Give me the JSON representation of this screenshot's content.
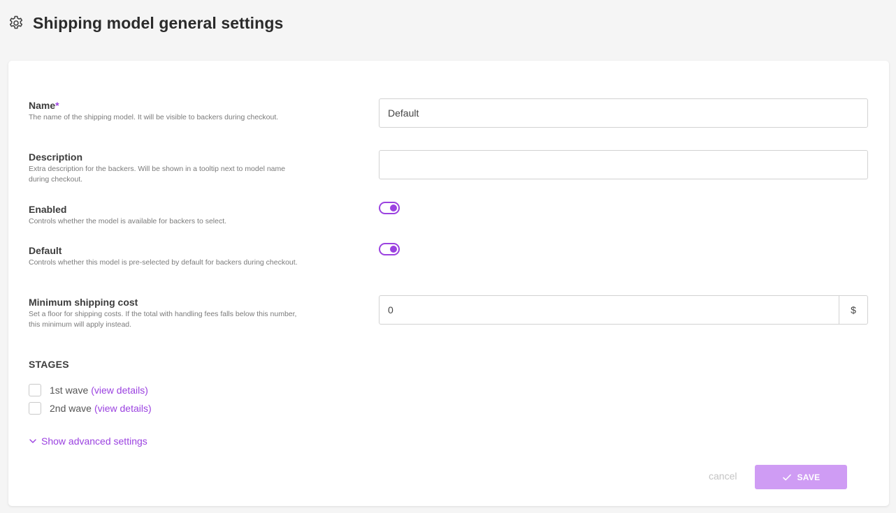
{
  "page": {
    "title": "Shipping model general settings"
  },
  "fields": {
    "name": {
      "label": "Name",
      "required_mark": "*",
      "help": "The name of the shipping model. It will be visible to backers during checkout.",
      "value": "Default"
    },
    "description": {
      "label": "Description",
      "help": "Extra description for the backers. Will be shown in a tooltip next to model name during checkout.",
      "value": ""
    },
    "enabled": {
      "label": "Enabled",
      "help": "Controls whether the model is available for backers to select.",
      "checked": true
    },
    "default": {
      "label": "Default",
      "help": "Controls whether this model is pre-selected by default for backers during checkout.",
      "checked": true
    },
    "min_cost": {
      "label": "Minimum shipping cost",
      "help": "Set a floor for shipping costs. If the total with handling fees falls below this number, this minimum will apply instead.",
      "value": "0",
      "currency": "$"
    }
  },
  "stages": {
    "title": "STAGES",
    "items": [
      {
        "label": "1st wave",
        "link": "(view details)",
        "checked": false
      },
      {
        "label": "2nd wave",
        "link": "(view details)",
        "checked": false
      }
    ]
  },
  "advanced": {
    "label": "Show advanced settings"
  },
  "actions": {
    "cancel": "cancel",
    "save": "SAVE"
  },
  "colors": {
    "accent": "#9b42e0",
    "save_bg": "#cf9cf4",
    "page_bg": "#f5f5f5"
  },
  "icons": {
    "header": "gear-icon",
    "advanced": "chevron-down-icon",
    "save": "check-icon"
  }
}
